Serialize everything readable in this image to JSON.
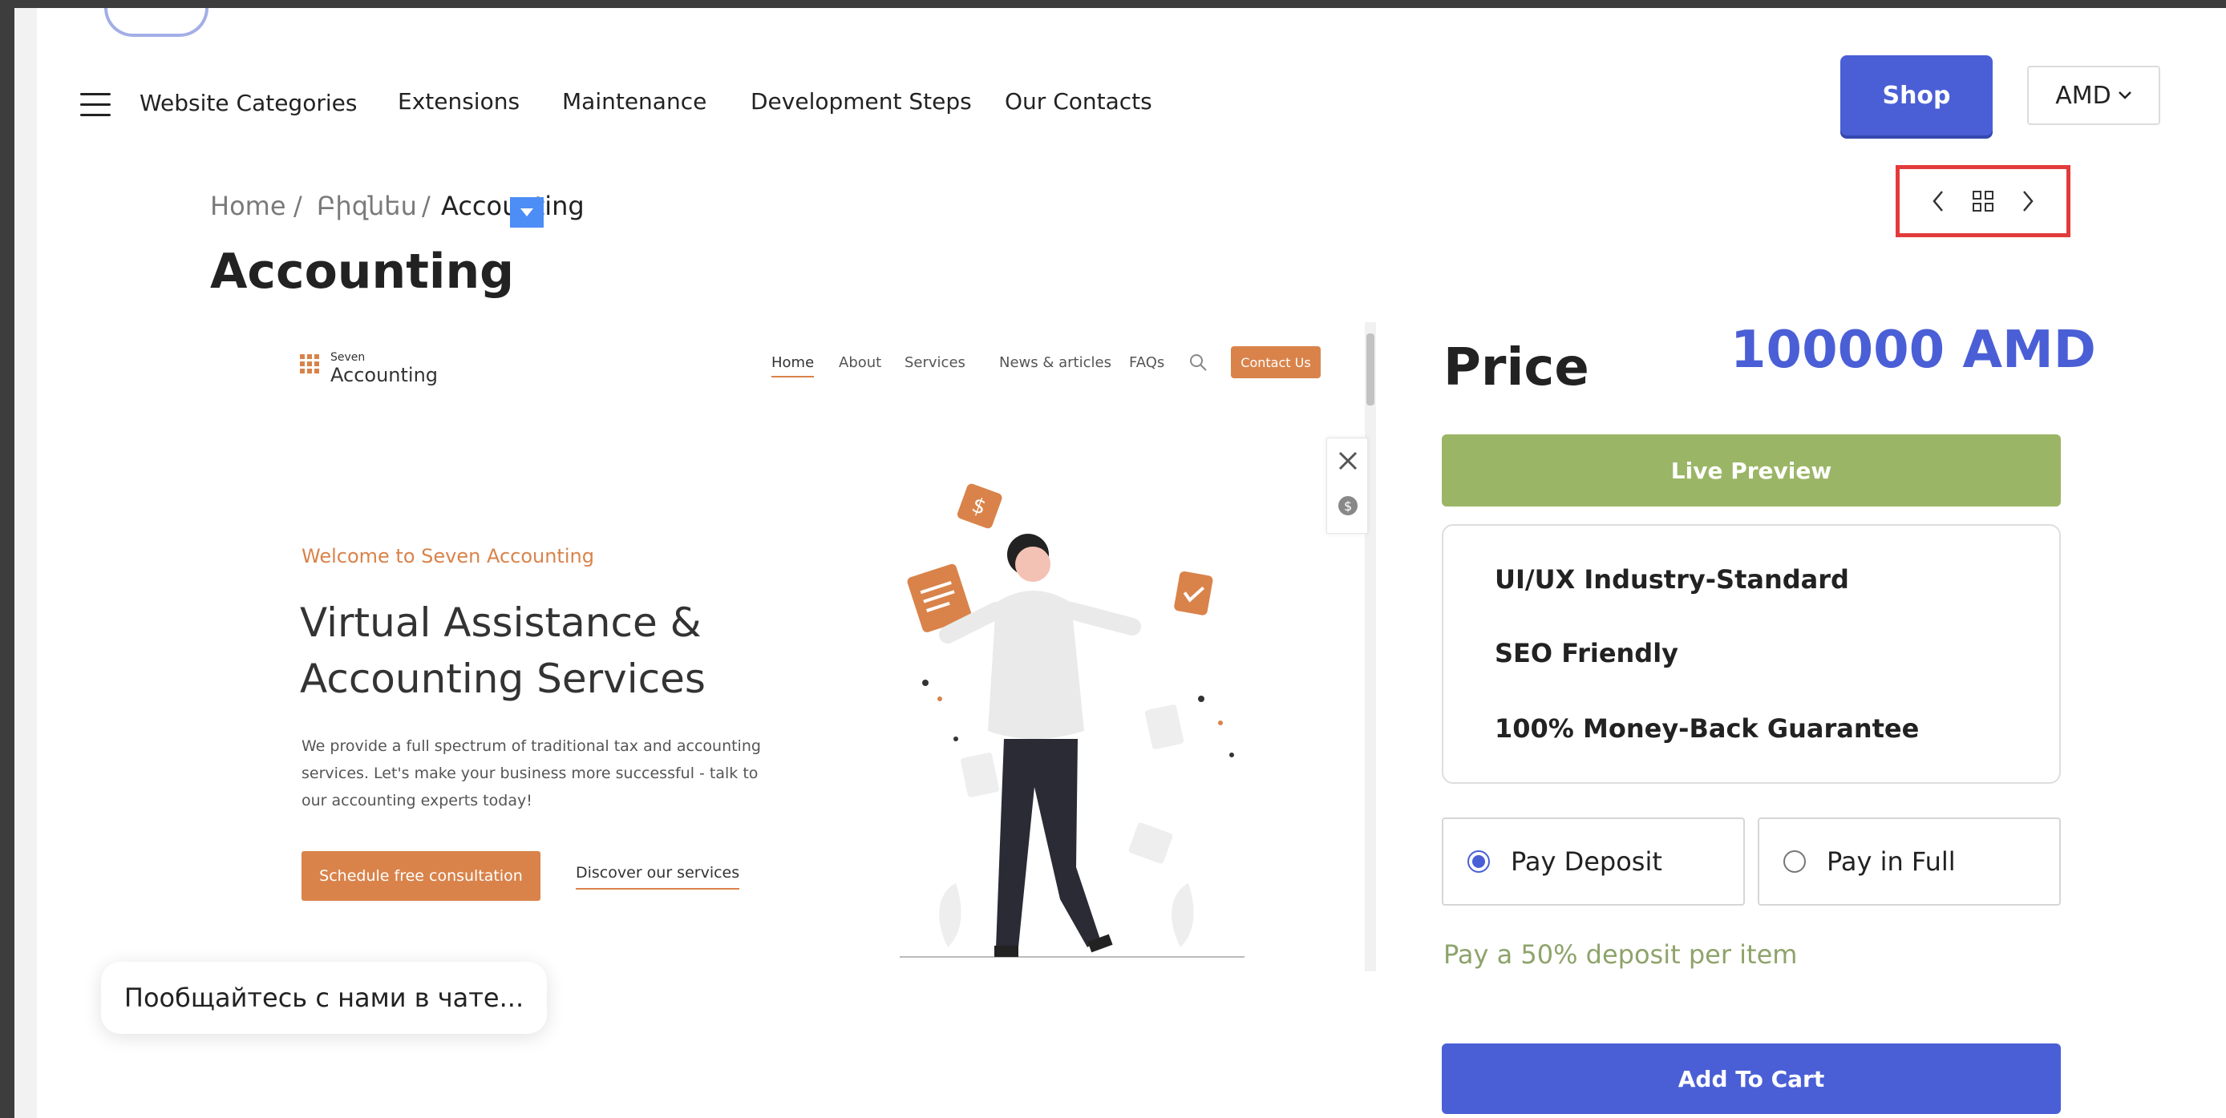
{
  "nav": {
    "categories": "Website Categories",
    "items": [
      "Extensions",
      "Maintenance",
      "Development Steps",
      "Our Contacts"
    ],
    "shop": "Shop",
    "currency": "AMD"
  },
  "breadcrumb": {
    "home": "Home",
    "parent": "Բիզնես",
    "current": "Accounting",
    "sep": "/"
  },
  "page_title": "Accounting",
  "preview": {
    "logo_small": "Seven",
    "logo_big": "Accounting",
    "nav": [
      "Home",
      "About",
      "Services",
      "News & articles",
      "FAQs"
    ],
    "contact": "Contact Us",
    "welcome": "Welcome to Seven Accounting",
    "headline": "Virtual Assistance & Accounting Services",
    "description": "We provide a full spectrum of traditional tax and accounting services. Let's make your business more successful - talk to our accounting experts today!",
    "cta_primary": "Schedule free consultation",
    "cta_secondary": "Discover our services"
  },
  "pricing": {
    "label": "Price",
    "value": "100000 AMD",
    "live_preview": "Live Preview",
    "features": [
      "UI/UX Industry-Standard",
      "SEO Friendly",
      "100% Money-Back Guarantee"
    ],
    "pay_deposit": "Pay Deposit",
    "pay_full": "Pay in Full",
    "selected": "Pay Deposit",
    "deposit_note": "Pay a 50% deposit per item",
    "add_to_cart": "Add To Cart"
  },
  "chat": {
    "text": "Пообщайтесь с нами в чате..."
  },
  "colors": {
    "brand": "#4a5fd6",
    "live_preview": "#9bb566",
    "preview_accent": "#d9834a",
    "highlight_box": "#e23b3b"
  }
}
